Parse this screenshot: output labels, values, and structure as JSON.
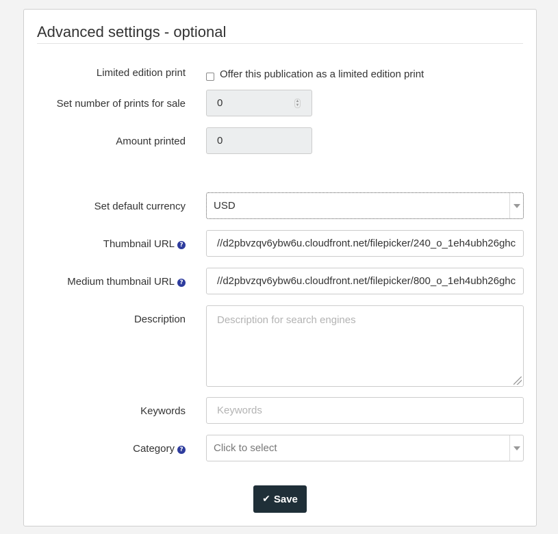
{
  "panel": {
    "title": "Advanced settings - optional"
  },
  "limited_edition": {
    "label": "Limited edition print",
    "checkbox_label": "Offer this publication as a limited edition print",
    "checked": false
  },
  "prints_for_sale": {
    "label": "Set number of prints for sale",
    "value": "0"
  },
  "amount_printed": {
    "label": "Amount printed",
    "value": "0"
  },
  "currency": {
    "label": "Set default currency",
    "value": "USD"
  },
  "thumbnail_url": {
    "label": "Thumbnail URL",
    "value": "//d2pbvzqv6ybw6u.cloudfront.net/filepicker/240_o_1eh4ubh26ghc"
  },
  "medium_thumbnail_url": {
    "label": "Medium thumbnail URL",
    "value": "//d2pbvzqv6ybw6u.cloudfront.net/filepicker/800_o_1eh4ubh26ghc"
  },
  "description": {
    "label": "Description",
    "placeholder": "Description for search engines"
  },
  "keywords": {
    "label": "Keywords",
    "placeholder": "Keywords"
  },
  "category": {
    "label": "Category",
    "placeholder": "Click to select"
  },
  "save": {
    "label": "Save"
  },
  "icons": {
    "help": "?",
    "check": "✔"
  },
  "colors": {
    "help_icon": "#2e3c9d",
    "save_button": "#1f2f38",
    "readonly_field": "#eceeef"
  }
}
